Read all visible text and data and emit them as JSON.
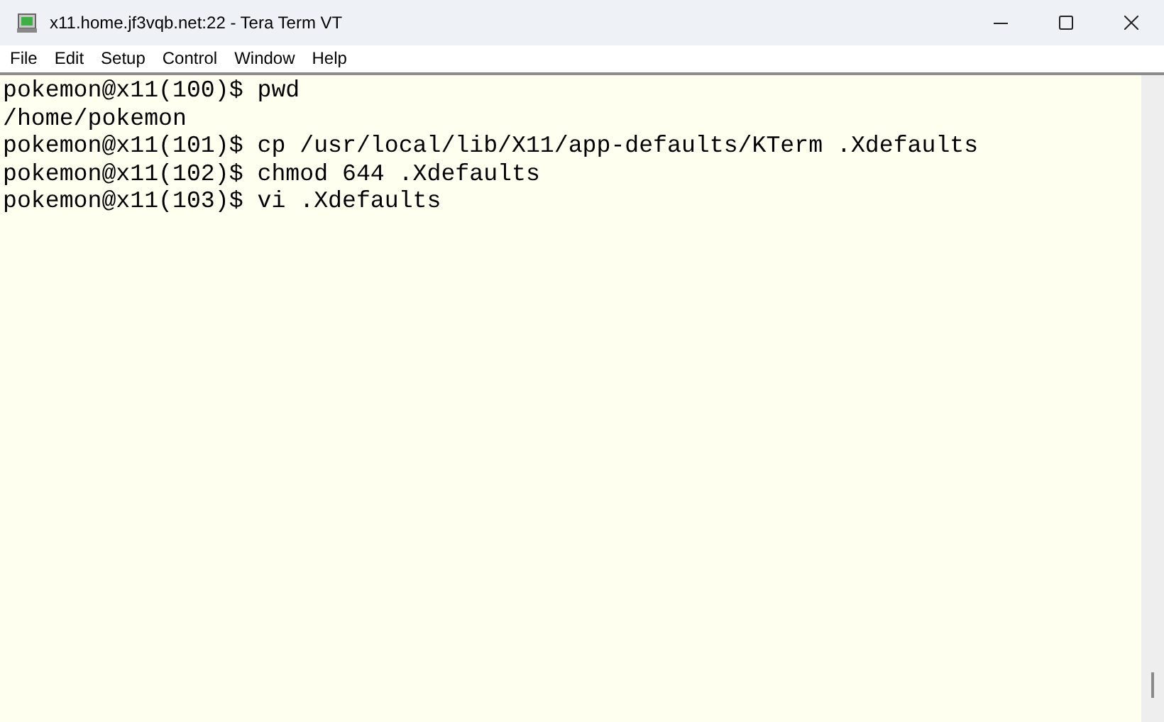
{
  "window": {
    "title": "x11.home.jf3vqb.net:22 - Tera Term VT"
  },
  "menu": [
    "File",
    "Edit",
    "Setup",
    "Control",
    "Window",
    "Help"
  ],
  "terminal": {
    "lines": [
      "pokemon@x11(100)$ pwd",
      "/home/pokemon",
      "pokemon@x11(101)$ cp /usr/local/lib/X11/app-defaults/KTerm .Xdefaults",
      "pokemon@x11(102)$ chmod 644 .Xdefaults",
      "pokemon@x11(103)$ vi .Xdefaults"
    ]
  }
}
